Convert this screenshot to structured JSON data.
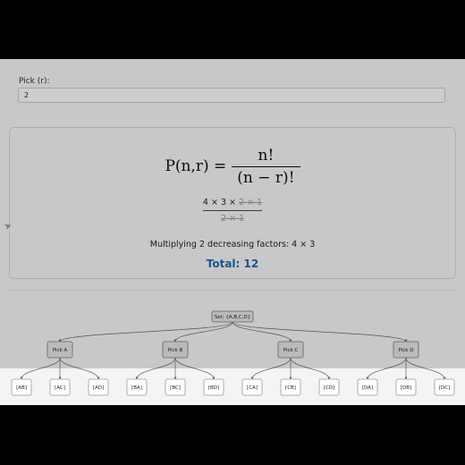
{
  "pick": {
    "label": "Pick (r):",
    "value": "2"
  },
  "formula": {
    "lhs": "P(n,r) =",
    "numerator": "n!",
    "denominator": "(n − r)!"
  },
  "calculation": {
    "numerator": {
      "kept": "4 × 3 × ",
      "cancelled": "2 × 1"
    },
    "denominator": {
      "cancelled": "2 × 1"
    }
  },
  "multiply_text": "Multiplying 2 decreasing factors: 4 × 3",
  "total_text": "Total: 12",
  "tree": {
    "root": "Set: {A,B,C,D}",
    "branches": [
      {
        "label": "Pick A",
        "leaves": [
          "[AB]",
          "[AC]",
          "[AD]"
        ]
      },
      {
        "label": "Pick B",
        "leaves": [
          "[BA]",
          "[BC]",
          "[BD]"
        ]
      },
      {
        "label": "Pick C",
        "leaves": [
          "[CA]",
          "[CB]",
          "[CD]"
        ]
      },
      {
        "label": "Pick D",
        "leaves": [
          "[DA]",
          "[DB]",
          "[DC]"
        ]
      }
    ]
  },
  "colors": {
    "total": "#1f6bb0",
    "background": "#f4f4f4",
    "overlay": "#000000"
  }
}
